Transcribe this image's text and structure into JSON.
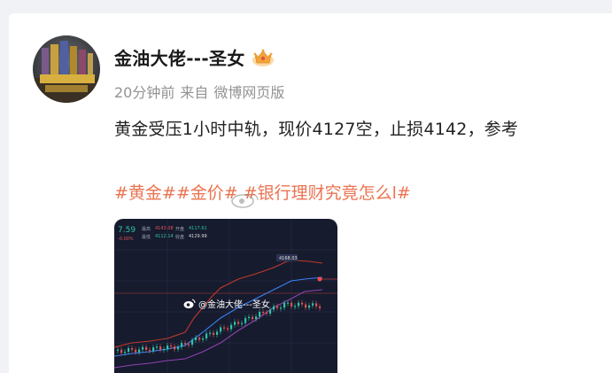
{
  "post": {
    "author": "金油大佬---圣女",
    "badge_icon": "crown-badge-icon",
    "time": "20分钟前",
    "source_prefix": "来自",
    "source": "微博网页版",
    "text": "黄金受压1小时中轨，现价4127空，止损4142，参考",
    "topics": "#黄金##金价#  #银行理财究竟怎么l#",
    "accent_color": "#eb7350"
  },
  "chart_image": {
    "price_left": "7.59",
    "change_left": "-0.00%",
    "label_1": "最高",
    "value_1": "4143.08",
    "label_2": "开盘",
    "value_2": "4117.61",
    "label_3": "最低",
    "value_3": "4112.14",
    "label_4": "收盘",
    "value_4": "4129.99",
    "peak_label": "4168.03",
    "watermark": "@金油大佬---圣女"
  }
}
